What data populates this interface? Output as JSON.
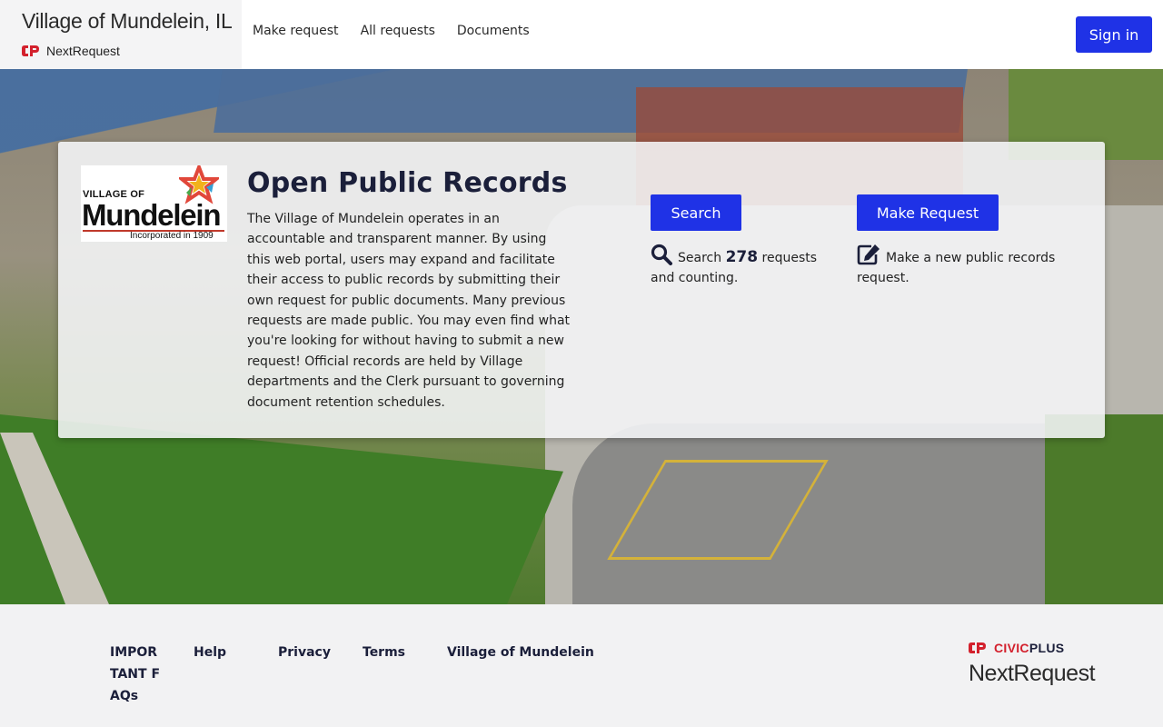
{
  "header": {
    "site_title": "Village of Mundelein, IL",
    "brand_name": "NextRequest",
    "nav": [
      {
        "label": "Make request"
      },
      {
        "label": "All requests"
      },
      {
        "label": "Documents"
      }
    ],
    "signin_label": "Sign in"
  },
  "card": {
    "logo": {
      "village": "VILLAGE OF",
      "name": "Mundelein",
      "incorporated": "Incorporated in 1909"
    },
    "title": "Open Public Records",
    "description": "The Village of Mundelein operates in an accountable and transparent manner. By using this web portal, users may expand and facilitate their access to public records by submitting their own request for public documents. Many previous requests are made public. You may even find what you're looking for without having to submit a new request! Official records are held by Village departments and the Clerk pursuant to governing document retention schedules.",
    "search": {
      "button_label": "Search",
      "text_prefix": "Search",
      "count": "278",
      "text_suffix": "requests and counting.",
      "icon": "search-icon"
    },
    "make_request": {
      "button_label": "Make Request",
      "text": "Make a new public records request.",
      "icon": "edit-icon"
    }
  },
  "footer": {
    "links": [
      {
        "label": "IMPORTANT FAQs"
      },
      {
        "label": "Help"
      },
      {
        "label": "Privacy"
      },
      {
        "label": "Terms"
      },
      {
        "label": "Village of Mundelein"
      }
    ],
    "civic_left": "CIVIC",
    "civic_right": "PLUS",
    "product": "NextRequest"
  },
  "colors": {
    "primary_button": "#1f32e6",
    "heading": "#1b1f3a",
    "civicplus_red": "#d3202c"
  }
}
